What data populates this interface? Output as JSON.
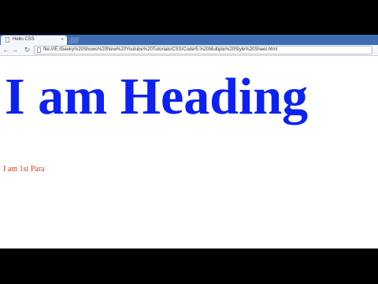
{
  "browser": {
    "tab_title": "Hello CSS",
    "tab_close": "×",
    "address_url": "file:///E:/Geeky%20Shows%20New%20Youtube%20Tutorials/CSS/Code/5.%20Multiple%20Style%20Sheet.html",
    "back_glyph": "←",
    "forward_glyph": "→",
    "reload_glyph": "↻"
  },
  "page": {
    "heading": "I am Heading",
    "paragraph": "I am 1st Para"
  },
  "colors": {
    "heading": "#0d21f2",
    "paragraph": "#e03a1c",
    "tabstrip": "#3d6bb4"
  },
  "icons": {
    "tab": "page-icon",
    "omnibox": "page-icon",
    "back": "arrow-left-icon",
    "forward": "arrow-right-icon",
    "reload": "reload-icon"
  }
}
